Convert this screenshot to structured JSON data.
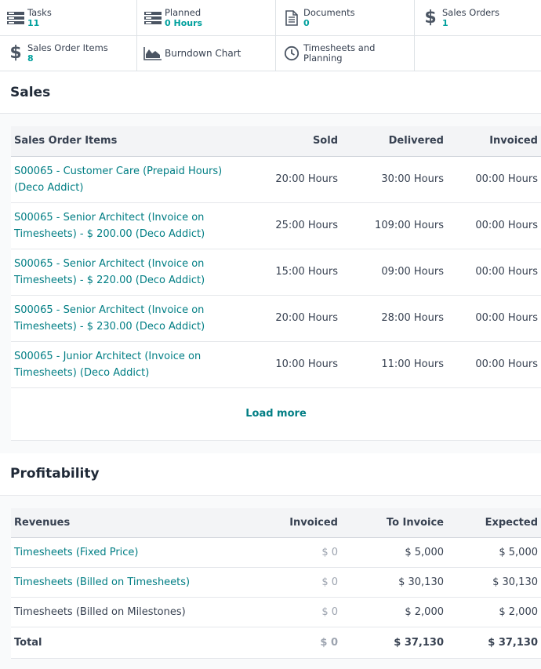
{
  "stat_buttons": {
    "tasks": {
      "label": "Tasks",
      "value": "11"
    },
    "planned": {
      "label": "Planned",
      "value": "0 Hours"
    },
    "documents": {
      "label": "Documents",
      "value": "0"
    },
    "sales_orders": {
      "label": "Sales Orders",
      "value": "1"
    },
    "sales_order_items": {
      "label": "Sales Order Items",
      "value": "8"
    },
    "burndown": {
      "label": "Burndown Chart"
    },
    "timesheets": {
      "label_line1": "Timesheets and",
      "label_line2": "Planning"
    }
  },
  "sales": {
    "title": "Sales",
    "headers": {
      "item": "Sales Order Items",
      "sold": "Sold",
      "delivered": "Delivered",
      "invoiced": "Invoiced"
    },
    "rows": [
      {
        "item": "S00065 - Customer Care (Prepaid Hours) (Deco Addict)",
        "sold": "20:00 Hours",
        "delivered": "30:00 Hours",
        "invoiced": "00:00 Hours"
      },
      {
        "item": "S00065 - Senior Architect (Invoice on Timesheets) - $ 200.00 (Deco Addict)",
        "sold": "25:00 Hours",
        "delivered": "109:00 Hours",
        "invoiced": "00:00 Hours"
      },
      {
        "item": "S00065 - Senior Architect (Invoice on Timesheets) - $ 220.00 (Deco Addict)",
        "sold": "15:00 Hours",
        "delivered": "09:00 Hours",
        "invoiced": "00:00 Hours"
      },
      {
        "item": "S00065 - Senior Architect (Invoice on Timesheets) - $ 230.00 (Deco Addict)",
        "sold": "20:00 Hours",
        "delivered": "28:00 Hours",
        "invoiced": "00:00 Hours"
      },
      {
        "item": "S00065 - Junior Architect (Invoice on Timesheets) (Deco Addict)",
        "sold": "10:00 Hours",
        "delivered": "11:00 Hours",
        "invoiced": "00:00 Hours"
      }
    ],
    "load_more": "Load more"
  },
  "profitability": {
    "title": "Profitability",
    "headers": {
      "revenues": "Revenues",
      "invoiced": "Invoiced",
      "to_invoice": "To Invoice",
      "expected": "Expected"
    },
    "rows": [
      {
        "label": "Timesheets (Fixed Price)",
        "invoiced": "$ 0",
        "to_invoice": "$ 5,000",
        "expected": "$ 5,000"
      },
      {
        "label": "Timesheets (Billed on Timesheets)",
        "invoiced": "$ 0",
        "to_invoice": "$ 30,130",
        "expected": "$ 30,130"
      },
      {
        "label": "Timesheets (Billed on Milestones)",
        "invoiced": "$ 0",
        "to_invoice": "$ 2,000",
        "expected": "$ 2,000"
      }
    ],
    "total": {
      "label": "Total",
      "invoiced": "$ 0",
      "to_invoice": "$ 37,130",
      "expected": "$ 37,130"
    }
  }
}
